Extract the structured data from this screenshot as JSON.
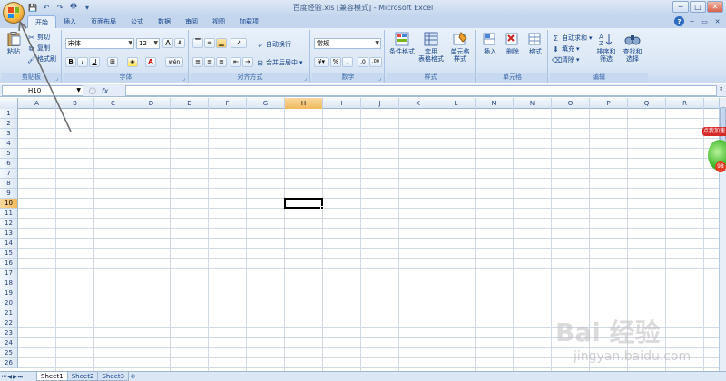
{
  "window": {
    "title": "百度经验.xls [兼容模式] - Microsoft Excel",
    "qat_more": "▾"
  },
  "tabs": [
    "开始",
    "插入",
    "页面布局",
    "公式",
    "数据",
    "审阅",
    "视图",
    "加载项"
  ],
  "ribbon": {
    "clipboard": {
      "label": "剪贴板",
      "paste": "粘贴",
      "cut": "剪切",
      "copy": "复制",
      "format_painter": "格式刷"
    },
    "font": {
      "label": "字体",
      "name": "宋体",
      "size": "12",
      "bold": "B",
      "italic": "I",
      "underline": "U",
      "grow": "A",
      "shrink": "A",
      "font_color": "A",
      "phonetic": "wén"
    },
    "alignment": {
      "label": "对齐方式",
      "wrap": "自动换行",
      "merge": "合并后居中"
    },
    "number": {
      "label": "数字",
      "format": "常规",
      "percent": "%",
      "comma": ",",
      "inc": ".0",
      "dec": ".00"
    },
    "styles": {
      "label": "样式",
      "conditional": "条件格式",
      "as_table": "套用\n表格格式",
      "cell_styles": "单元格\n样式"
    },
    "cells": {
      "label": "单元格",
      "insert": "插入",
      "delete": "删除",
      "format": "格式"
    },
    "editing": {
      "label": "编辑",
      "autosum": "自动求和",
      "fill": "填充",
      "clear": "清除",
      "sort": "排序和\n筛选",
      "find": "查找和\n选择"
    }
  },
  "formula": {
    "name_box": "H10",
    "fx": "fx"
  },
  "grid": {
    "columns": [
      "A",
      "B",
      "C",
      "D",
      "E",
      "F",
      "G",
      "H",
      "I",
      "J",
      "K",
      "L",
      "M",
      "N",
      "O",
      "P",
      "Q",
      "R"
    ],
    "selected_column": "H",
    "rows": [
      "1",
      "2",
      "3",
      "4",
      "5",
      "6",
      "7",
      "8",
      "9",
      "10",
      "11",
      "12",
      "13",
      "14",
      "15",
      "16",
      "17",
      "18",
      "19",
      "20",
      "21",
      "22",
      "23",
      "24",
      "25",
      "26"
    ],
    "selected_row": "10"
  },
  "sheets": [
    "Sheet1",
    "Sheet2",
    "Sheet3"
  ],
  "active_sheet": "Sheet1",
  "side_widget": {
    "badge": "点我加速",
    "num": "98"
  },
  "watermark": {
    "brand": "Bai  经验",
    "sub": "jingyan.baidu.com"
  }
}
